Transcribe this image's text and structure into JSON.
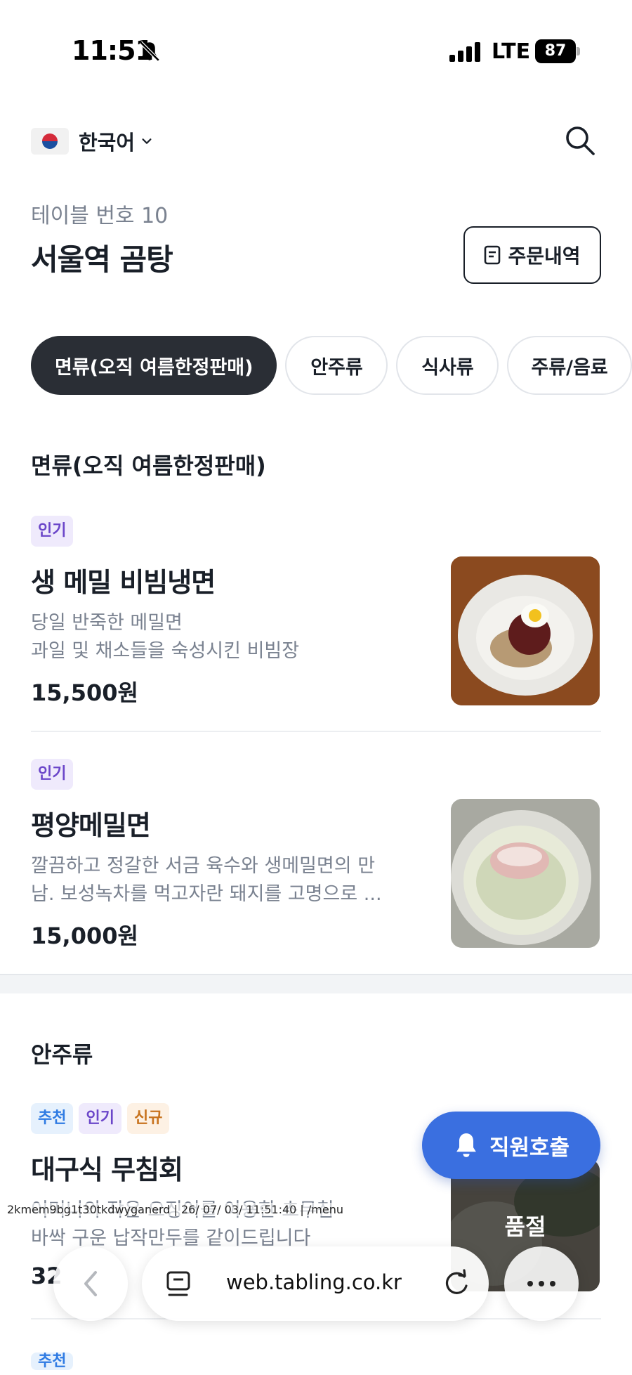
{
  "status_bar": {
    "time": "11:51",
    "network": "LTE",
    "battery": "87"
  },
  "header": {
    "language": "한국어",
    "table_number": "테이블 번호 10",
    "store_name": "서울역 곰탕",
    "order_history_label": "주문내역"
  },
  "categories": [
    {
      "label": "면류(오직 여름한정판매)",
      "active": true
    },
    {
      "label": "안주류",
      "active": false
    },
    {
      "label": "식사류",
      "active": false
    },
    {
      "label": "주류/음료",
      "active": false
    }
  ],
  "sections": [
    {
      "title": "면류(오직 여름한정판매)",
      "items": [
        {
          "badges": [
            "인기"
          ],
          "name": "생 메밀 비빔냉면",
          "desc_line1": "당일 반죽한 메밀면",
          "desc_line2": "과일 및 채소들을 숙성시킨 비빔장",
          "price": "15,500원"
        },
        {
          "badges": [
            "인기"
          ],
          "name": "평양메밀면",
          "desc_line1": "깔끔하고 정갈한 서금 육수와 생메밀면의 만",
          "desc_line2": "남. 보성녹차를 먹고자란 돼지를 고명으로 ...",
          "price": "15,000원"
        }
      ]
    },
    {
      "title": "안주류",
      "items": [
        {
          "badges": [
            "추천",
            "인기",
            "신규"
          ],
          "name": "대구식 무침회",
          "desc_line1": "어머니의 작은 오징어를 이용한 초무침",
          "desc_line2": "바싹 구운 납작만두를 같이드립니다",
          "price": "32",
          "status": "품절"
        }
      ]
    }
  ],
  "next_item_badge": "추천",
  "staff_call_label": "직원호출",
  "debug_text": "2kmem9bg1t30tkdwyganerd | 26/ 07/ 03/ 11:51:40 | /menu",
  "browser": {
    "url": "web.tabling.co.kr"
  },
  "colors": {
    "accent": "#3a6fe0",
    "chip_active": "#2a2e35",
    "badge_popular": "#6b46c9",
    "badge_recommend": "#2f7be3",
    "badge_new": "#c8731e"
  }
}
